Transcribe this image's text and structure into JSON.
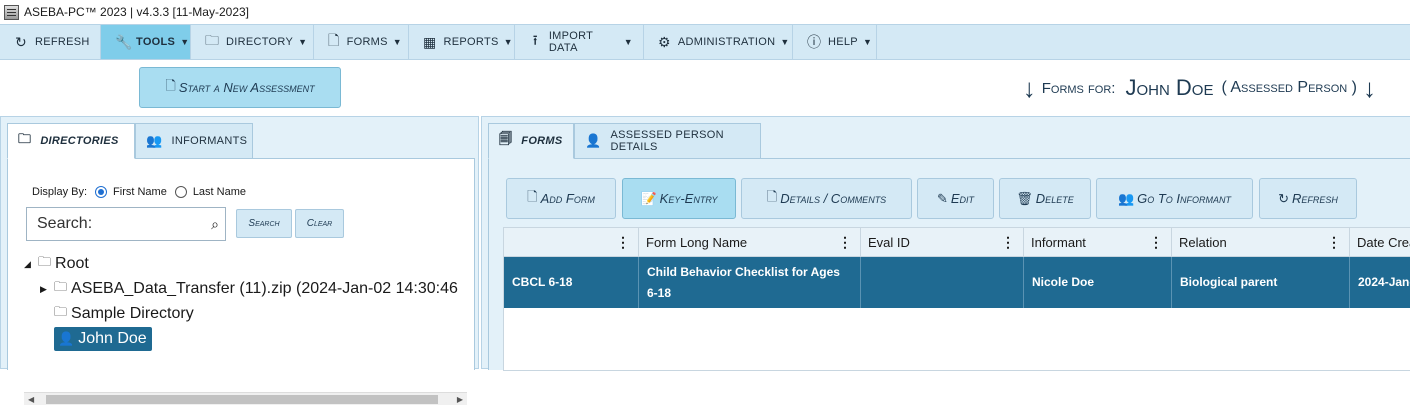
{
  "title": "ASEBA-PC™ 2023  |  v4.3.3   [11-May-2023]",
  "menu": [
    {
      "label": "REFRESH",
      "icon": "refresh-icon",
      "caret": false
    },
    {
      "label": "TOOLS",
      "icon": "wrench-icon",
      "caret": true
    },
    {
      "label": "DIRECTORY",
      "icon": "folder-icon",
      "caret": true
    },
    {
      "label": "FORMS",
      "icon": "document-icon",
      "caret": true
    },
    {
      "label": "REPORTS",
      "icon": "grid-icon",
      "caret": true
    },
    {
      "label": "IMPORT DATA",
      "icon": "upload-icon",
      "caret": true
    },
    {
      "label": "ADMINISTRATION",
      "icon": "gear-icon",
      "caret": true
    },
    {
      "label": "HELP",
      "icon": "help-icon",
      "caret": true
    }
  ],
  "start_button": "Start a New Assessment",
  "forms_for": {
    "label": "Forms for:",
    "name": "John Doe",
    "role": "( Assessed Person )"
  },
  "left_tabs": {
    "directories": "DIRECTORIES",
    "informants": "INFORMANTS"
  },
  "display_by": {
    "label": "Display By:",
    "first_name": "First Name",
    "last_name": "Last Name",
    "selected": "First Name"
  },
  "search": {
    "placeholder": "Search:",
    "search_button": "Search",
    "clear_button": "Clear"
  },
  "tree": {
    "root": "Root",
    "transfer": "ASEBA_Data_Transfer (11).zip (2024-Jan-02 14:30:46",
    "sample": "Sample Directory",
    "person": "John Doe"
  },
  "right_tabs": {
    "forms": "FORMS",
    "details": "ASSESSED PERSON DETAILS"
  },
  "actions": {
    "add_form": "Add Form",
    "key_entry": "Key-Entry",
    "details": "Details / Comments",
    "edit": "Edit",
    "delete": "Delete",
    "go_informant": "Go To Informant",
    "refresh": "Refresh"
  },
  "grid": {
    "columns": [
      "",
      "Form Long Name",
      "Eval ID",
      "Informant",
      "Relation",
      "Date Crea"
    ],
    "row": [
      "CBCL 6-18",
      "Child Behavior Checklist for Ages 6-18",
      "",
      "Nicole Doe",
      "Biological parent",
      "2024-Jan-"
    ]
  },
  "colors": {
    "menubar": "#d4e9f5",
    "active": "#7fcdea",
    "selected_row": "#1f6a92",
    "panel": "#e3f1f9"
  }
}
